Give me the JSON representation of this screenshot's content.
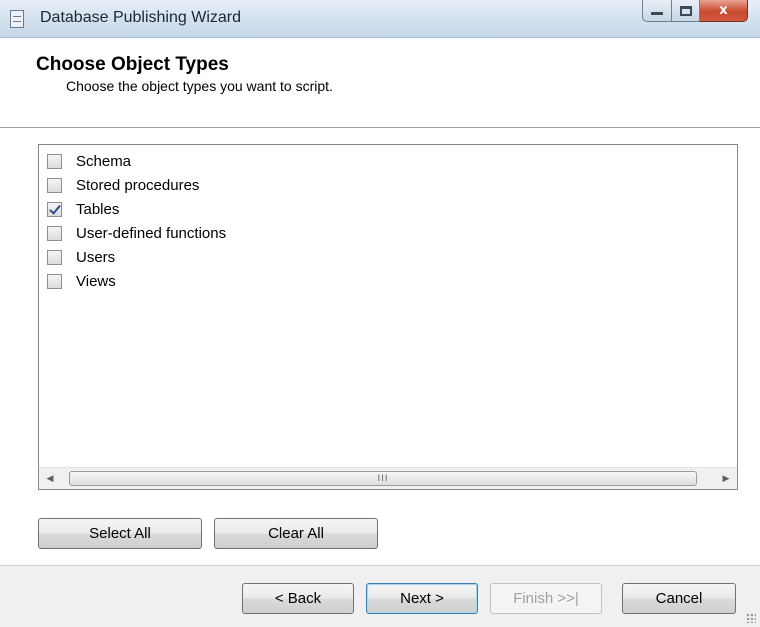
{
  "window": {
    "title": "Database Publishing Wizard",
    "controls": {
      "minimize": "minimize",
      "maximize": "maximize",
      "close": "x"
    }
  },
  "header": {
    "title": "Choose Object Types",
    "subtitle": "Choose the object types you want to script."
  },
  "object_types": [
    {
      "label": "Schema",
      "checked": false
    },
    {
      "label": "Stored procedures",
      "checked": false
    },
    {
      "label": "Tables",
      "checked": true
    },
    {
      "label": "User-defined functions",
      "checked": false
    },
    {
      "label": "Users",
      "checked": false
    },
    {
      "label": "Views",
      "checked": false
    }
  ],
  "scrollbar": {
    "thumb_grip": "III",
    "left_arrow": "◀",
    "right_arrow": "▶"
  },
  "actions": {
    "select_all": "Select All",
    "clear_all": "Clear All"
  },
  "footer": {
    "back": "< Back",
    "next": "Next >",
    "finish": "Finish >>|",
    "cancel": "Cancel",
    "finish_enabled": false
  }
}
